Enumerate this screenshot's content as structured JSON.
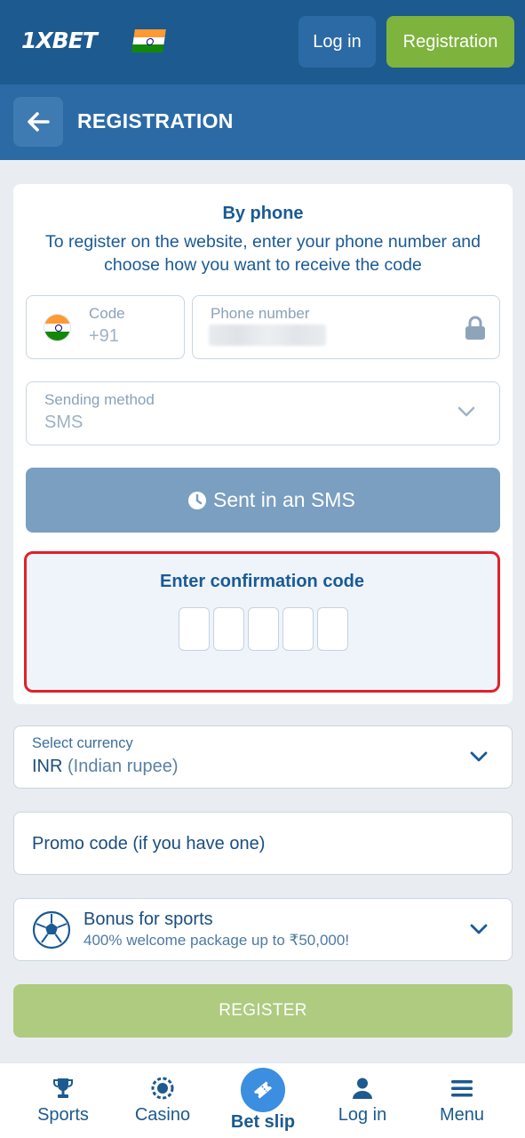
{
  "header": {
    "logo_text": "1XBET",
    "login_label": "Log in",
    "registration_label": "Registration"
  },
  "titlebar": {
    "title": "REGISTRATION"
  },
  "form": {
    "heading": "By phone",
    "description": "To register on the website, enter your phone number and choose how you want to receive the code",
    "code_label": "Code",
    "code_value": "+91",
    "phone_label": "Phone number",
    "sending_label": "Sending method",
    "sending_value": "SMS",
    "sms_button_label": "Sent in an SMS",
    "confirm_title": "Enter confirmation code"
  },
  "currency": {
    "label": "Select currency",
    "code": "INR",
    "name": "(Indian rupee)"
  },
  "promo": {
    "placeholder": "Promo code (if you have one)"
  },
  "bonus": {
    "title": "Bonus for sports",
    "subtitle": "400% welcome package up to ₹50,000!"
  },
  "register_button": "REGISTER",
  "bottom_nav": {
    "sports": "Sports",
    "casino": "Casino",
    "bet_slip": "Bet slip",
    "login": "Log in",
    "menu": "Menu"
  },
  "colors": {
    "header_bg": "#1c5a8f",
    "title_bg": "#2c6aa5",
    "accent_green": "#7eb33d",
    "highlight_red": "#e2202a"
  }
}
